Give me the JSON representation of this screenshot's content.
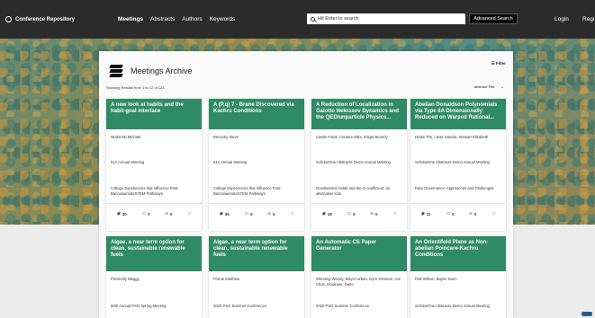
{
  "nav": {
    "brand": "Conference Repository",
    "links": [
      "Meetings",
      "Abstracts",
      "Authors",
      "Keywords"
    ],
    "search_placeholder": "Hit Enter to search",
    "advanced_search": "Advanced Search",
    "login": "Login",
    "register": "Regi"
  },
  "archive": {
    "title": "Meetings Archive",
    "filter": "Filter",
    "results_text": "Showing Results from 1 to 12 of 123",
    "sort_label": "Abstract Title"
  },
  "cards_row1": [
    {
      "title": "A new look at habits and the habit-goal interface",
      "authors": "Modzeski Michael",
      "meeting": "51A Annual Meeting",
      "session": "College Experiences that Influence Post-BaccalaureateSTEM Pathways",
      "views": "30",
      "comments": "0",
      "score": "0",
      "stars": ""
    },
    {
      "title": "A (P,q) 7 - Brane Discovered via Kachru Conditions",
      "authors": "Revucky Steve",
      "meeting": "51A Annual Meeting",
      "session": "College Experiences that Influence Post-BaccalaureateSTEM Pathways",
      "views": "35",
      "comments": "0",
      "score": "0",
      "stars": ""
    },
    {
      "title": "A Reduction of Localization in Gaiotto Nekrasov Dynamics and the QED/unparticle Physics...",
      "authors": "Castle Frank, Couture Mike, Edgar Beverly",
      "meeting": "ScholarOne Abstracts Demo Annual Meeting",
      "session": "Gravitational Holds and the G-coefficient: an alternative look",
      "views": "18",
      "comments": "0",
      "score": "0",
      "stars": ""
    },
    {
      "title": "Abelian Donaldson Polynomials via Type IIA Dimensionally Reduced on Warped Rational...",
      "authors": "Drake Tim, Lantz Sandra, Stewart Elizabeth",
      "meeting": "ScholarOne Abstracts Demo Annual Meeting",
      "session": "Data Governance: Approaches and Challenges",
      "views": "11",
      "comments": "0",
      "score": "0",
      "stars": ""
    }
  ],
  "cards_row2": [
    {
      "title": "Algae, a near term option for clean, sustainable renewable fuels",
      "authors": "Ponticelly Meggy",
      "meeting": "50th Annual PSG Spring Meeting"
    },
    {
      "title": "Algae, a near term option for clean, sustainable renewable fuels",
      "authors": "Frome Matthew",
      "meeting": "2020 PSG Summer Conference"
    },
    {
      "title": "An Automatic CS Paper Generator",
      "authors": "Wernling Wendy, Meyer Urban, Gym Torrance, Aor Chris, Dowlover, Dario",
      "meeting": "2020 PSG Summer Conference"
    },
    {
      "title": "An Orientifold Plane as Non-abelian Poincare-Kachru Conditions",
      "authors": "Fisk Wilson, Bayne Karin",
      "meeting": "ScholarOne Abstracts Demo Annual Meeting"
    }
  ],
  "colors": {
    "card_header": "#2f8a66",
    "nav_bg": "#2b2b2b"
  }
}
